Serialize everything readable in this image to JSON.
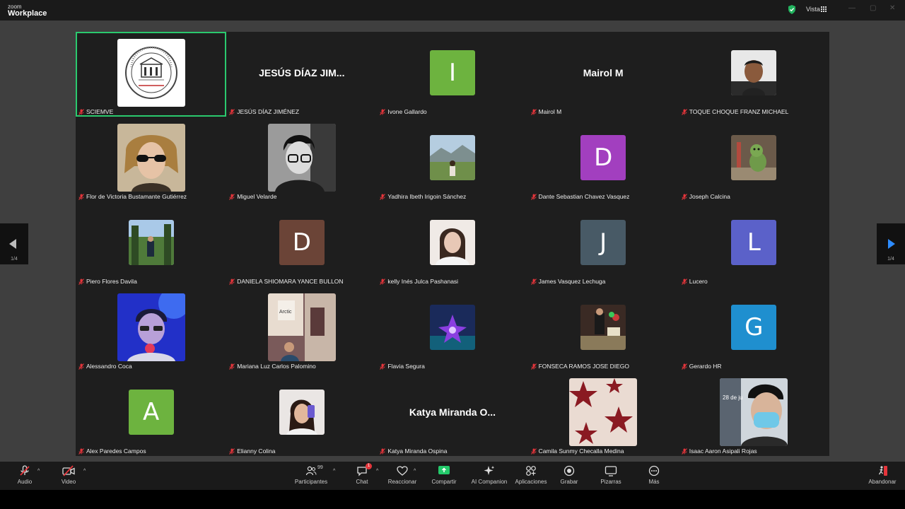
{
  "app": {
    "logo_top": "zoom",
    "logo_bottom": "Workplace",
    "view_label": "Vista"
  },
  "colors": {
    "active_border": "#2ac96e",
    "muted_red": "#e5353b",
    "share_green": "#23c96a"
  },
  "pagination": {
    "left": "1/4",
    "right": "1/4"
  },
  "participants": [
    {
      "name": "SCIEMVE",
      "kind": "logo",
      "active": true
    },
    {
      "name": "JESÚS DÍAZ JIMÉNEZ",
      "kind": "text",
      "display": "JESÚS DÍAZ JIM..."
    },
    {
      "name": "Ivone Gallardo",
      "kind": "letter",
      "letter": "I",
      "color": "#6db33f"
    },
    {
      "name": "Mairol M",
      "kind": "text",
      "display": "Mairol M"
    },
    {
      "name": "TOQUE CHOQUE FRANZ MICHAEL",
      "kind": "photo",
      "icon": "person-photo"
    },
    {
      "name": "Flor de Victoria Bustamante Gutiérrez",
      "kind": "video",
      "icon": "person-sunglasses-video"
    },
    {
      "name": "Miguel Velarde",
      "kind": "video",
      "icon": "person-bw-video"
    },
    {
      "name": "Yadhira Ibeth Irigoin Sánchez",
      "kind": "photo",
      "icon": "landscape-photo"
    },
    {
      "name": "Dante Sebastian Chavez Vasquez",
      "kind": "letter",
      "letter": "D",
      "color": "#a23fbf"
    },
    {
      "name": "Joseph Calcina",
      "kind": "photo",
      "icon": "dinosaur-toy-photo"
    },
    {
      "name": "Piero Flores Davila",
      "kind": "photo",
      "icon": "park-photo"
    },
    {
      "name": "DANIELA SHIOMARA YANCE BULLON",
      "kind": "letter",
      "letter": "D",
      "color": "#6b4437"
    },
    {
      "name": "kelly Inés Julca Pashanasi",
      "kind": "photo",
      "icon": "selfie-photo"
    },
    {
      "name": "James Vasquez Lechuga",
      "kind": "letter",
      "letter": "J",
      "color": "#485a66"
    },
    {
      "name": "Lucero",
      "kind": "letter",
      "letter": "L",
      "color": "#5b61c9"
    },
    {
      "name": "Alessandro Coca",
      "kind": "video",
      "icon": "person-blue-light-video"
    },
    {
      "name": "Mariana Luz Carlos Palomino",
      "kind": "video",
      "icon": "poster-collage-video"
    },
    {
      "name": "Flavia Segura",
      "kind": "photo",
      "icon": "purple-flower-photo"
    },
    {
      "name": "FONSECA RAMOS JOSE DIEGO",
      "kind": "photo",
      "icon": "celebration-photo"
    },
    {
      "name": "Gerardo HR",
      "kind": "letter",
      "letter": "G",
      "color": "#1f8fcf"
    },
    {
      "name": "Alex Paredes Campos",
      "kind": "letter",
      "letter": "A",
      "color": "#6db33f"
    },
    {
      "name": "Elianny Colina",
      "kind": "photo",
      "icon": "mirror-selfie-photo"
    },
    {
      "name": "Katya Miranda Ospina",
      "kind": "text",
      "display": "Katya Miranda O..."
    },
    {
      "name": "Camila Sunmy Checalla Medina",
      "kind": "video",
      "icon": "stars-pattern-video"
    },
    {
      "name": "Isaac Aaron Asipali Rojas",
      "kind": "video",
      "icon": "person-mask-video"
    }
  ],
  "toolbar": {
    "audio": "Audio",
    "video": "Video",
    "participants": "Participantes",
    "participants_count": "99",
    "chat": "Chat",
    "chat_badge": "1",
    "react": "Reaccionar",
    "share": "Compartir",
    "ai": "AI Companion",
    "apps": "Aplicaciones",
    "record": "Grabar",
    "whiteboards": "Pizarras",
    "more": "Más",
    "leave": "Abandonar"
  }
}
